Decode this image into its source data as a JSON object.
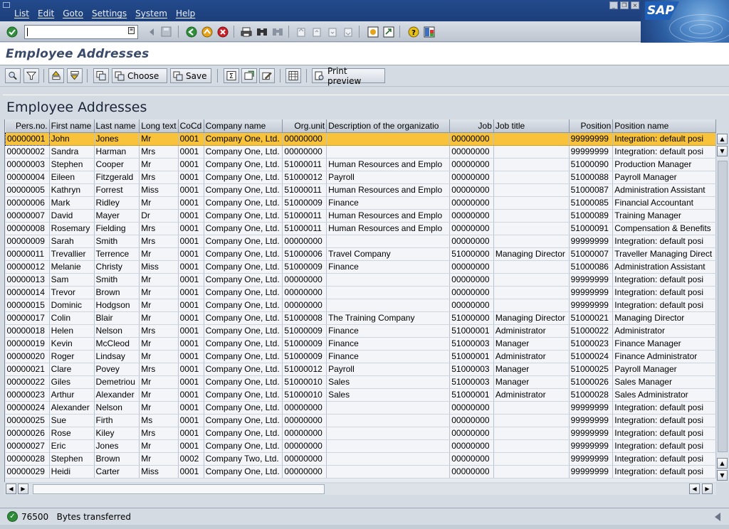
{
  "menu": {
    "items": [
      "List",
      "Edit",
      "Goto",
      "Settings",
      "System",
      "Help"
    ]
  },
  "brand": {
    "logo_text": "SAP"
  },
  "toolbar": {
    "command_value": ""
  },
  "title": "Employee Addresses",
  "app_toolbar": {
    "choose_label": "Choose",
    "save_label": "Save",
    "print_preview_label": "Print preview"
  },
  "grid": {
    "title": "Employee Addresses",
    "columns": [
      "Pers.no.",
      "First name",
      "Last name",
      "Long text",
      "CoCd",
      "Company name",
      "Org.unit",
      "Description of the organizatio",
      "Job",
      "Job title",
      "Position",
      "Position name"
    ],
    "rows": [
      [
        "00000001",
        "John",
        "Jones",
        "Mr",
        "0001",
        "Company One, Ltd.",
        "00000000",
        "",
        "00000000",
        "",
        "99999999",
        "Integration: default posi"
      ],
      [
        "00000002",
        "Sandra",
        "Harman",
        "Mrs",
        "0001",
        "Company One, Ltd.",
        "00000000",
        "",
        "00000000",
        "",
        "99999999",
        "Integration: default posi"
      ],
      [
        "00000003",
        "Stephen",
        "Cooper",
        "Mr",
        "0001",
        "Company One, Ltd.",
        "51000011",
        "Human Resources and Emplo",
        "00000000",
        "",
        "51000090",
        "Production Manager"
      ],
      [
        "00000004",
        "Eileen",
        "Fitzgerald",
        "Mrs",
        "0001",
        "Company One, Ltd.",
        "51000012",
        "Payroll",
        "00000000",
        "",
        "51000088",
        "Payroll Manager"
      ],
      [
        "00000005",
        "Kathryn",
        "Forrest",
        "Miss",
        "0001",
        "Company One, Ltd.",
        "51000011",
        "Human Resources and Emplo",
        "00000000",
        "",
        "51000087",
        "Administration Assistant"
      ],
      [
        "00000006",
        "Mark",
        "Ridley",
        "Mr",
        "0001",
        "Company One, Ltd.",
        "51000009",
        "Finance",
        "00000000",
        "",
        "51000085",
        "Financial Accountant"
      ],
      [
        "00000007",
        "David",
        "Mayer",
        "Dr",
        "0001",
        "Company One, Ltd.",
        "51000011",
        "Human Resources and Emplo",
        "00000000",
        "",
        "51000089",
        "Training Manager"
      ],
      [
        "00000008",
        "Rosemary",
        "Fielding",
        "Mrs",
        "0001",
        "Company One, Ltd.",
        "51000011",
        "Human Resources and Emplo",
        "00000000",
        "",
        "51000091",
        "Compensation & Benefits"
      ],
      [
        "00000009",
        "Sarah",
        "Smith",
        "Mrs",
        "0001",
        "Company One, Ltd.",
        "00000000",
        "",
        "00000000",
        "",
        "99999999",
        "Integration: default posi"
      ],
      [
        "00000011",
        "Trevallier",
        "Terrence",
        "Mr",
        "0001",
        "Company One, Ltd.",
        "51000006",
        "Travel Company",
        "51000000",
        "Managing Director",
        "51000007",
        "Traveller Managing Direct"
      ],
      [
        "00000012",
        "Melanie",
        "Christy",
        "Miss",
        "0001",
        "Company One, Ltd.",
        "51000009",
        "Finance",
        "00000000",
        "",
        "51000086",
        "Administration Assistant"
      ],
      [
        "00000013",
        "Sam",
        "Smith",
        "Mr",
        "0001",
        "Company One, Ltd.",
        "00000000",
        "",
        "00000000",
        "",
        "99999999",
        "Integration: default posi"
      ],
      [
        "00000014",
        "Trevor",
        "Brown",
        "Mr",
        "0001",
        "Company One, Ltd.",
        "00000000",
        "",
        "00000000",
        "",
        "99999999",
        "Integration: default posi"
      ],
      [
        "00000015",
        "Dominic",
        "Hodgson",
        "Mr",
        "0001",
        "Company One, Ltd.",
        "00000000",
        "",
        "00000000",
        "",
        "99999999",
        "Integration: default posi"
      ],
      [
        "00000017",
        "Colin",
        "Blair",
        "Mr",
        "0001",
        "Company One, Ltd.",
        "51000008",
        "The Training Company",
        "51000000",
        "Managing Director",
        "51000021",
        "Managing Director"
      ],
      [
        "00000018",
        "Helen",
        "Nelson",
        "Mrs",
        "0001",
        "Company One, Ltd.",
        "51000009",
        "Finance",
        "51000001",
        "Administrator",
        "51000022",
        "Administrator"
      ],
      [
        "00000019",
        "Kevin",
        "McCleod",
        "Mr",
        "0001",
        "Company One, Ltd.",
        "51000009",
        "Finance",
        "51000003",
        "Manager",
        "51000023",
        "Finance Manager"
      ],
      [
        "00000020",
        "Roger",
        "Lindsay",
        "Mr",
        "0001",
        "Company One, Ltd.",
        "51000009",
        "Finance",
        "51000001",
        "Administrator",
        "51000024",
        "Finance Administrator"
      ],
      [
        "00000021",
        "Clare",
        "Povey",
        "Mrs",
        "0001",
        "Company One, Ltd.",
        "51000012",
        "Payroll",
        "51000003",
        "Manager",
        "51000025",
        "Payroll Manager"
      ],
      [
        "00000022",
        "Giles",
        "Demetriou",
        "Mr",
        "0001",
        "Company One, Ltd.",
        "51000010",
        "Sales",
        "51000003",
        "Manager",
        "51000026",
        "Sales Manager"
      ],
      [
        "00000023",
        "Arthur",
        "Alexander",
        "Mr",
        "0001",
        "Company One, Ltd.",
        "51000010",
        "Sales",
        "51000001",
        "Administrator",
        "51000028",
        "Sales Administrator"
      ],
      [
        "00000024",
        "Alexander",
        "Nelson",
        "Mr",
        "0001",
        "Company One, Ltd.",
        "00000000",
        "",
        "00000000",
        "",
        "99999999",
        "Integration: default posi"
      ],
      [
        "00000025",
        "Sue",
        "Firth",
        "Ms",
        "0001",
        "Company One, Ltd.",
        "00000000",
        "",
        "00000000",
        "",
        "99999999",
        "Integration: default posi"
      ],
      [
        "00000026",
        "Rose",
        "Kiley",
        "Mrs",
        "0001",
        "Company One, Ltd.",
        "00000000",
        "",
        "00000000",
        "",
        "99999999",
        "Integration: default posi"
      ],
      [
        "00000027",
        "Eric",
        "Jones",
        "Mr",
        "0001",
        "Company One, Ltd.",
        "00000000",
        "",
        "00000000",
        "",
        "99999999",
        "Integration: default posi"
      ],
      [
        "00000028",
        "Stephen",
        "Brown",
        "Mr",
        "0002",
        "Company Two, Ltd.",
        "00000000",
        "",
        "00000000",
        "",
        "99999999",
        "Integration: default posi"
      ],
      [
        "00000029",
        "Heidi",
        "Carter",
        "Miss",
        "0001",
        "Company One, Ltd.",
        "00000000",
        "",
        "00000000",
        "",
        "99999999",
        "Integration: default posi"
      ]
    ]
  },
  "status": {
    "message": "76500   Bytes transferred"
  }
}
